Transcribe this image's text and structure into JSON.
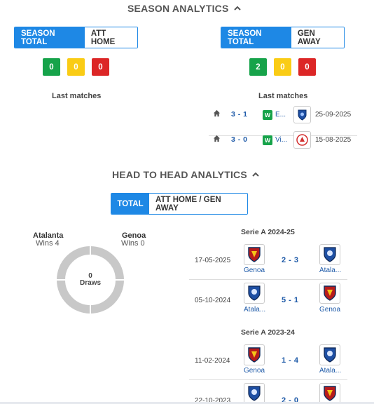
{
  "season": {
    "title": "SEASON ANALYTICS",
    "left": {
      "toggle": [
        "SEASON TOTAL",
        "ATT HOME"
      ],
      "counts": [
        "0",
        "0",
        "0"
      ],
      "last_label": "Last matches"
    },
    "right": {
      "toggle": [
        "SEASON TOTAL",
        "GEN AWAY"
      ],
      "counts": [
        "2",
        "0",
        "0"
      ],
      "last_label": "Last matches",
      "matches": [
        {
          "score": "3 - 1",
          "result": "W",
          "team": "E...",
          "logo": "empoli-crest-icon",
          "date": "25-09-2025"
        },
        {
          "score": "3 - 0",
          "result": "W",
          "team": "Vi...",
          "logo": "vicenza-crest-icon",
          "date": "15-08-2025"
        }
      ]
    }
  },
  "h2h": {
    "title": "HEAD TO HEAD ANALYTICS",
    "toggle": [
      "TOTAL",
      "ATT HOME / GEN AWAY"
    ],
    "home": {
      "name": "Atalanta",
      "wins": "Wins 4"
    },
    "away": {
      "name": "Genoa",
      "wins": "Wins 0"
    },
    "draws": {
      "value": "0",
      "label": "Draws"
    },
    "competitions": [
      {
        "title": "Serie A 2024-25",
        "matches": [
          {
            "date": "17-05-2025",
            "home": "Genoa",
            "score": "2 - 3",
            "away": "Atala..."
          },
          {
            "date": "05-10-2024",
            "home": "Atala...",
            "score": "5 - 1",
            "away": "Genoa"
          }
        ]
      },
      {
        "title": "Serie A 2023-24",
        "matches": [
          {
            "date": "11-02-2024",
            "home": "Genoa",
            "score": "1 - 4",
            "away": "Atala..."
          },
          {
            "date": "22-10-2023",
            "home": "",
            "score": "2 - 0",
            "away": ""
          }
        ]
      }
    ]
  },
  "colors": {
    "accent": "#1e88e5",
    "win": "#16a34a",
    "draw": "#facc15",
    "loss": "#dc2626",
    "link": "#1e5aa8"
  }
}
